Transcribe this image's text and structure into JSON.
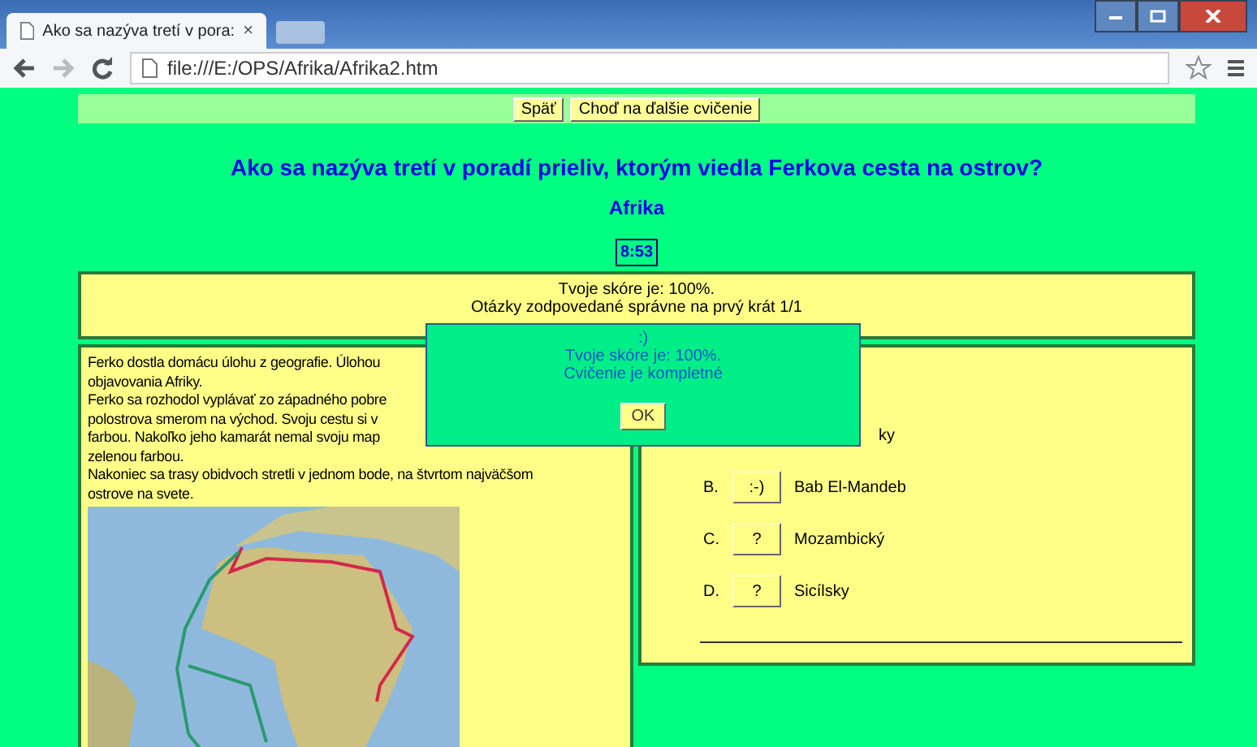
{
  "browser": {
    "tab_title": "Ako sa nazýva tretí v pora:",
    "tab_close": "×",
    "address": "file:///E:/OPS/Afrika/Afrika2.htm"
  },
  "nav_buttons": [
    "Späť",
    "Choď na ďalšie cvičenie"
  ],
  "question": "Ako sa nazýva tretí v poradí prieliv, ktorým viedla Ferkova cesta na ostrov?",
  "subtitle": "Afrika",
  "timer": "8:53",
  "score_lines": [
    "Tvoje skóre je: 100%.",
    "Otázky zodpovedané správne na prvý krát 1/1"
  ],
  "story_lines": [
    "Ferko dostla domácu úlohu z geografie. Úlohou",
    "objavovania Afriky.",
    "Ferko sa rozhodol vyplávať zo západného pobre",
    "polostrova smerom na východ. Svoju cestu si v",
    "farbou. Nakoľko jeho kamarát nemal svoju map",
    "zelenou farbou.",
    "Nakoniec sa trasy obidvoch stretli v jednom bode, na štvrtom najväčšom",
    "ostrove na svete."
  ],
  "options": [
    {
      "kind": "partial",
      "label": "ky"
    },
    {
      "kind": "full",
      "letter": "B.",
      "button": ":-)",
      "label": "Bab El-Mandeb"
    },
    {
      "kind": "full",
      "letter": "C.",
      "button": "?",
      "label": "Mozambický"
    },
    {
      "kind": "full",
      "letter": "D.",
      "button": "?",
      "label": "Sicílsky"
    }
  ],
  "dialog": {
    "lines": [
      ":)",
      "Tvoje skóre je: 100%.",
      "Cvičenie je kompletné"
    ],
    "button": "OK"
  }
}
